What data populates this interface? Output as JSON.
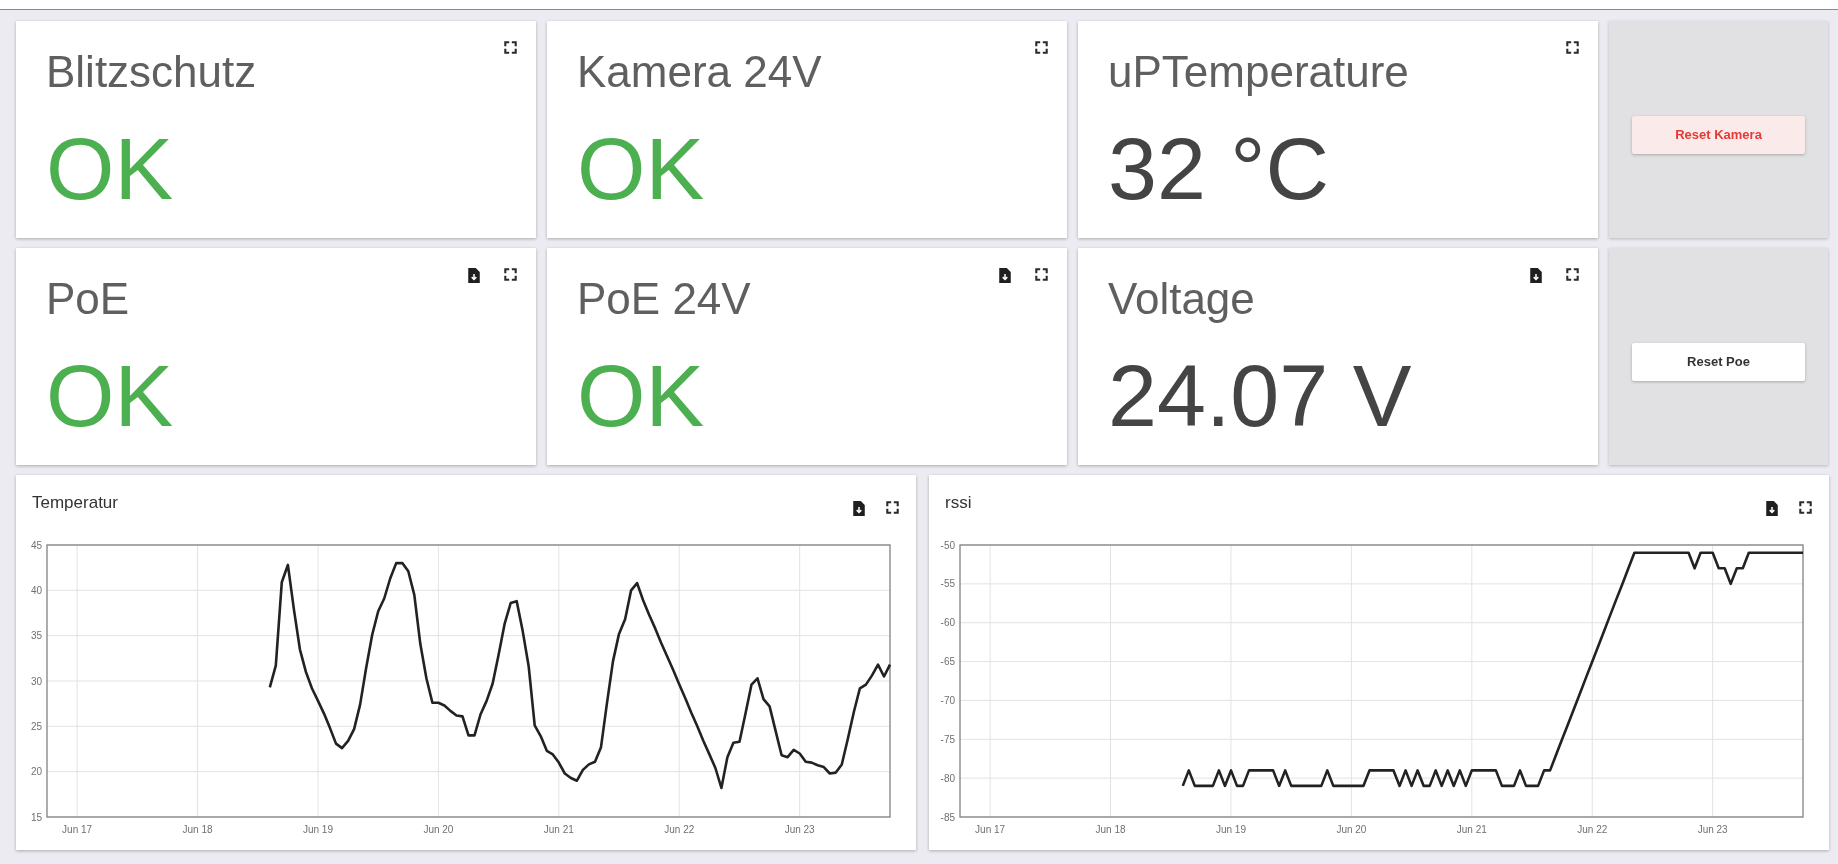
{
  "rows": [
    {
      "tiles": [
        {
          "title": "Blitzschutz",
          "value": "OK",
          "kind": "status",
          "download_button": false
        },
        {
          "title": "Kamera 24V",
          "value": "OK",
          "kind": "status",
          "download_button": false
        },
        {
          "title": "uPTemperature",
          "value": "32 °C",
          "kind": "reading",
          "download_button": false
        }
      ],
      "action": {
        "label": "Reset Kamera",
        "kind": "alert"
      }
    },
    {
      "tiles": [
        {
          "title": "PoE",
          "value": "OK",
          "kind": "status",
          "download_button": true
        },
        {
          "title": "PoE 24V",
          "value": "OK",
          "kind": "status",
          "download_button": true
        },
        {
          "title": "Voltage",
          "value": "24.07 V",
          "kind": "reading",
          "download_button": true
        }
      ],
      "action": {
        "label": "Reset Poe",
        "kind": "plain"
      }
    }
  ],
  "charts": [
    {
      "download_button": true,
      "chart_data": {
        "type": "line",
        "title": "Temperatur",
        "grid": true,
        "categories": [
          null,
          null,
          null,
          null,
          null,
          "Jun 17",
          null,
          null,
          null,
          null,
          null,
          null,
          null,
          null,
          null,
          null,
          null,
          null,
          null,
          null,
          null,
          null,
          null,
          null,
          null,
          "Jun 18",
          null,
          null,
          null,
          null,
          null,
          null,
          null,
          null,
          null,
          null,
          null,
          null,
          null,
          null,
          null,
          null,
          null,
          null,
          null,
          "Jun 19",
          null,
          null,
          null,
          null,
          null,
          null,
          null,
          null,
          null,
          null,
          null,
          null,
          null,
          null,
          null,
          null,
          null,
          null,
          null,
          "Jun 20",
          null,
          null,
          null,
          null,
          null,
          null,
          null,
          null,
          null,
          null,
          null,
          null,
          null,
          null,
          null,
          null,
          null,
          null,
          null,
          "Jun 21",
          null,
          null,
          null,
          null,
          null,
          null,
          null,
          null,
          null,
          null,
          null,
          null,
          null,
          null,
          null,
          null,
          null,
          null,
          null,
          "Jun 22",
          null,
          null,
          null,
          null,
          null,
          null,
          null,
          null,
          null,
          null,
          null,
          null,
          null,
          null,
          null,
          null,
          null,
          null,
          null,
          "Jun 23",
          null,
          null,
          null,
          null,
          null,
          null,
          null,
          null,
          null,
          null,
          null,
          null,
          null,
          null,
          null
        ],
        "series": [
          {
            "color": "#222222",
            "values": [
              null,
              null,
              null,
              null,
              null,
              null,
              null,
              null,
              null,
              null,
              null,
              null,
              null,
              null,
              null,
              null,
              null,
              null,
              null,
              null,
              null,
              null,
              null,
              null,
              null,
              null,
              null,
              null,
              null,
              null,
              null,
              null,
              null,
              null,
              null,
              null,
              null,
              29.3,
              31.7,
              40.9,
              42.8,
              37.9,
              33.5,
              31.0,
              29.2,
              27.8,
              26.4,
              24.8,
              23.1,
              22.6,
              23.4,
              24.7,
              27.4,
              31.4,
              35.1,
              37.7,
              39.1,
              41.3,
              43.0,
              43.0,
              42.1,
              39.5,
              34.1,
              30.3,
              27.6,
              27.6,
              27.3,
              26.7,
              26.2,
              26.1,
              24.0,
              24.0,
              26.3,
              27.8,
              29.7,
              32.9,
              36.3,
              38.6,
              38.8,
              35.5,
              31.6,
              25.1,
              23.9,
              22.3,
              21.9,
              21.0,
              19.8,
              19.3,
              19.0,
              20.2,
              20.8,
              21.1,
              22.7,
              27.6,
              32.2,
              35.2,
              36.8,
              40.0,
              40.8,
              38.9,
              37.3,
              35.8,
              34.2,
              32.7,
              31.2,
              29.6,
              28.1,
              26.5,
              25.0,
              23.4,
              21.9,
              20.4,
              18.2,
              21.6,
              23.2,
              23.3,
              26.4,
              29.6,
              30.3,
              28.0,
              27.2,
              24.5,
              21.8,
              21.6,
              22.4,
              22.0,
              21.1,
              21.0,
              20.7,
              20.5,
              19.8,
              19.9,
              20.8,
              23.6,
              26.6,
              29.2,
              29.6,
              30.6,
              31.8,
              30.5,
              31.8
            ]
          }
        ],
        "ylim": [
          15,
          45
        ],
        "yticks": [
          15,
          20,
          25,
          30,
          35,
          40,
          45
        ]
      }
    },
    {
      "download_button": true,
      "chart_data": {
        "type": "line",
        "title": "rssi",
        "grid": true,
        "categories": [
          null,
          null,
          null,
          null,
          null,
          "Jun 17",
          null,
          null,
          null,
          null,
          null,
          null,
          null,
          null,
          null,
          null,
          null,
          null,
          null,
          null,
          null,
          null,
          null,
          null,
          null,
          "Jun 18",
          null,
          null,
          null,
          null,
          null,
          null,
          null,
          null,
          null,
          null,
          null,
          null,
          null,
          null,
          null,
          null,
          null,
          null,
          null,
          "Jun 19",
          null,
          null,
          null,
          null,
          null,
          null,
          null,
          null,
          null,
          null,
          null,
          null,
          null,
          null,
          null,
          null,
          null,
          null,
          null,
          "Jun 20",
          null,
          null,
          null,
          null,
          null,
          null,
          null,
          null,
          null,
          null,
          null,
          null,
          null,
          null,
          null,
          null,
          null,
          null,
          null,
          "Jun 21",
          null,
          null,
          null,
          null,
          null,
          null,
          null,
          null,
          null,
          null,
          null,
          null,
          null,
          null,
          null,
          null,
          null,
          null,
          null,
          "Jun 22",
          null,
          null,
          null,
          null,
          null,
          null,
          null,
          null,
          null,
          null,
          null,
          null,
          null,
          null,
          null,
          null,
          null,
          null,
          null,
          "Jun 23",
          null,
          null,
          null,
          null,
          null,
          null,
          null,
          null,
          null,
          null,
          null,
          null,
          null,
          null,
          null
        ],
        "series": [
          {
            "color": "#222222",
            "values": [
              null,
              null,
              null,
              null,
              null,
              null,
              null,
              null,
              null,
              null,
              null,
              null,
              null,
              null,
              null,
              null,
              null,
              null,
              null,
              null,
              null,
              null,
              null,
              null,
              null,
              null,
              null,
              null,
              null,
              null,
              null,
              null,
              null,
              null,
              null,
              null,
              null,
              -81,
              -79,
              -81,
              -81,
              -81,
              -81,
              -79,
              -81,
              -79,
              -81,
              -81,
              -79,
              -79,
              -79,
              -79,
              -79,
              -81,
              -79,
              -81,
              -81,
              -81,
              -81,
              -81,
              -81,
              -79,
              -81,
              -81,
              -81,
              -81,
              -81,
              -81,
              -79,
              -79,
              -79,
              -79,
              -79,
              -81,
              -79,
              -81,
              -79,
              -81,
              -81,
              -79,
              -81,
              -79,
              -81,
              -79,
              -81,
              -79,
              -79,
              -79,
              -79,
              -79,
              -81,
              -81,
              -81,
              -79,
              -81,
              -81,
              -81,
              -79,
              -79,
              -77,
              -75,
              -73,
              -71,
              -69,
              -67,
              -65,
              -63,
              -61,
              -59,
              -57,
              -55,
              -53,
              -51,
              -51,
              -51,
              -51,
              -51,
              -51,
              -51,
              -51,
              -51,
              -51,
              -53,
              -51,
              -51,
              -51,
              -53,
              -53,
              -55,
              -53,
              -53,
              -51,
              -51,
              -51,
              -51,
              -51,
              -51,
              -51,
              -51,
              -51,
              -51
            ]
          }
        ],
        "ylim": [
          -85,
          -50
        ],
        "yticks": [
          -85,
          -80,
          -75,
          -70,
          -65,
          -60,
          -55,
          -50
        ]
      }
    }
  ]
}
